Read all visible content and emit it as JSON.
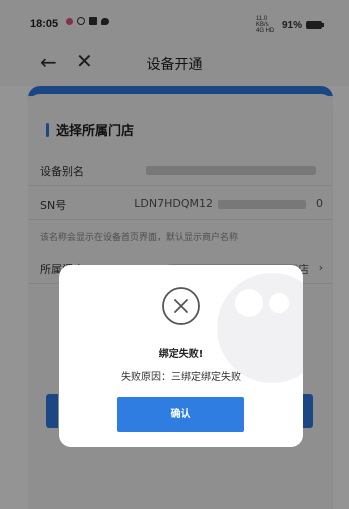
{
  "status_bar": {
    "time": "18:05",
    "signal": "11.0 KB/s 4G HD",
    "battery": "91%"
  },
  "title_bar": {
    "back_icon": "arrow-left-icon",
    "close_icon": "close-icon",
    "title": "设备开通"
  },
  "form": {
    "section_title": "选择所属门店",
    "alias_label": "设备别名",
    "sn_label": "SN号",
    "sn_value_prefix": "LDN7HDQM12",
    "sn_value_suffix": "0",
    "hint": "该名称会显示在设备首页界面，默认显示商户名称",
    "store_label": "所属门店",
    "store_value_suffix": "店"
  },
  "dialog": {
    "icon": "error-x-icon",
    "title": "绑定失败!",
    "message": "失败原因：三绑定绑定失败",
    "confirm_label": "确认"
  },
  "colors": {
    "accent": "#2f7de1",
    "overlay": "rgba(0,0,0,0.42)"
  }
}
